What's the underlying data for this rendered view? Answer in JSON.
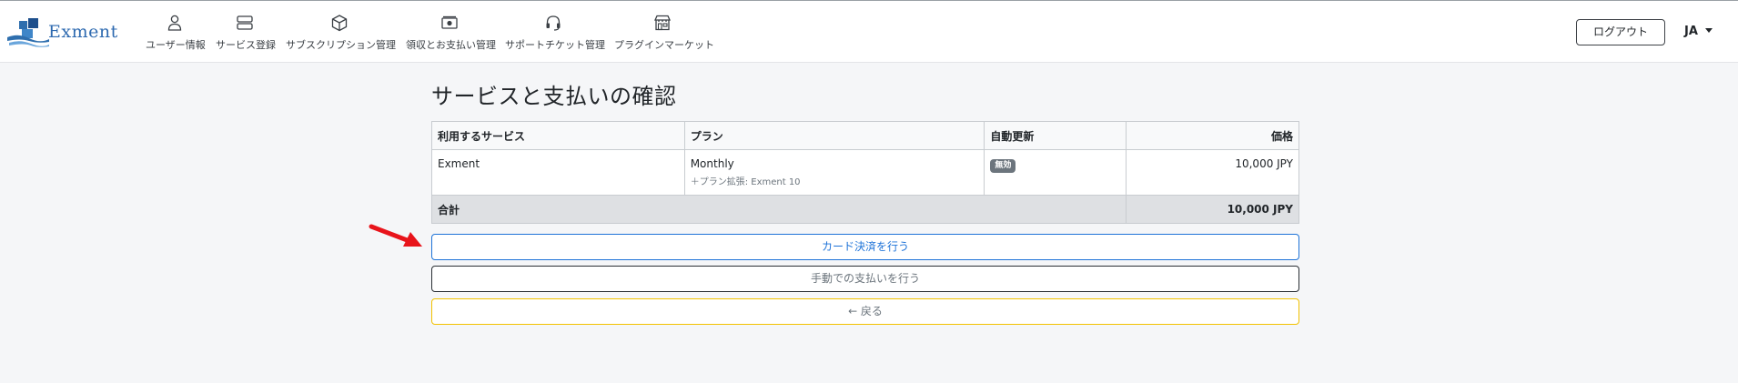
{
  "header": {
    "logo_text": "Exment",
    "nav": [
      {
        "label": "ユーザー情報",
        "icon": "user-icon"
      },
      {
        "label": "サービス登録",
        "icon": "server-icon"
      },
      {
        "label": "サブスクリプション管理",
        "icon": "box-icon"
      },
      {
        "label": "領収とお支払い管理",
        "icon": "cash-icon"
      },
      {
        "label": "サポートチケット管理",
        "icon": "headset-icon"
      },
      {
        "label": "プラグインマーケット",
        "icon": "shop-icon"
      }
    ],
    "logout_label": "ログアウト",
    "language": "JA"
  },
  "page": {
    "title": "サービスと支払いの確認"
  },
  "table": {
    "headers": {
      "service": "利用するサービス",
      "plan": "プラン",
      "auto_renew": "自動更新",
      "price": "価格"
    },
    "rows": [
      {
        "service": "Exment",
        "plan": "Monthly",
        "plan_extension": "＋プラン拡張: Exment 10",
        "auto_renew": "無効",
        "price": "10,000 JPY"
      }
    ],
    "footer": {
      "label": "合計",
      "total": "10,000 JPY"
    }
  },
  "actions": {
    "card_payment": "カード決済を行う",
    "manual_payment": "手動での支払いを行う",
    "back": "← 戻る"
  },
  "colors": {
    "primary": "#1e73d8",
    "warning": "#f2c200",
    "annotation_arrow": "#e8141b"
  }
}
